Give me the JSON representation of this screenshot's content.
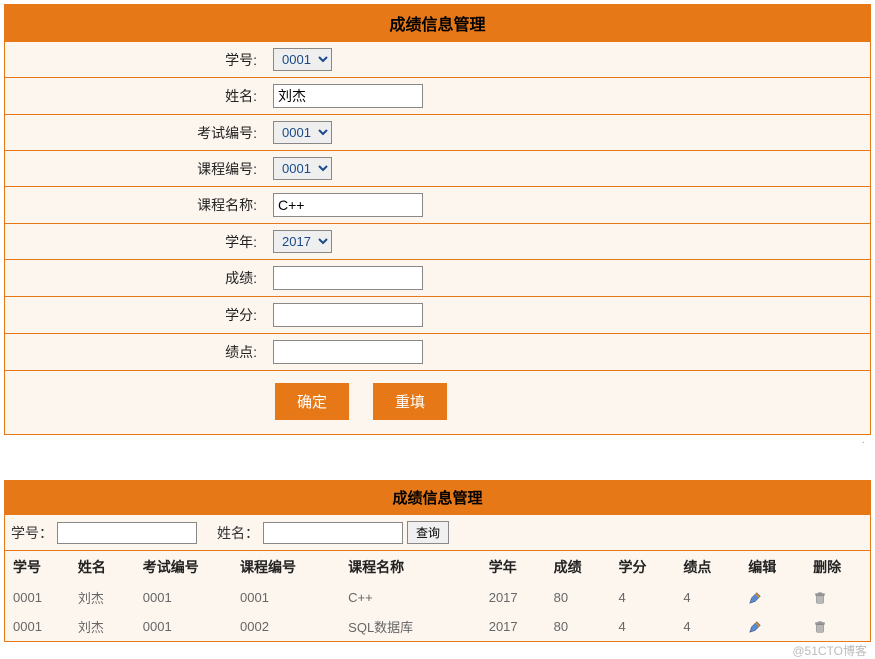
{
  "upper": {
    "title": "成绩信息管理",
    "fields": {
      "student_id": {
        "label": "学号:",
        "value": "0001"
      },
      "name": {
        "label": "姓名:",
        "value": "刘杰"
      },
      "exam_id": {
        "label": "考试编号:",
        "value": "0001"
      },
      "course_id": {
        "label": "课程编号:",
        "value": "0001"
      },
      "course_name": {
        "label": "课程名称:",
        "value": "C++"
      },
      "year": {
        "label": "学年:",
        "value": "2017"
      },
      "score": {
        "label": "成绩:",
        "value": ""
      },
      "credit": {
        "label": "学分:",
        "value": ""
      },
      "gpa": {
        "label": "绩点:",
        "value": ""
      }
    },
    "buttons": {
      "ok": "确定",
      "reset": "重填"
    }
  },
  "lower": {
    "title": "成绩信息管理",
    "search": {
      "id_label": "学号：",
      "name_label": "姓名：",
      "id_value": "",
      "name_value": "",
      "btn": "查询"
    },
    "columns": [
      "学号",
      "姓名",
      "考试编号",
      "课程编号",
      "课程名称",
      "学年",
      "成绩",
      "学分",
      "绩点",
      "编辑",
      "删除"
    ],
    "rows": [
      {
        "id": "0001",
        "name": "刘杰",
        "exam": "0001",
        "course": "0001",
        "cname": "C++",
        "year": "2017",
        "score": "80",
        "credit": "4",
        "gpa": "4"
      },
      {
        "id": "0001",
        "name": "刘杰",
        "exam": "0001",
        "course": "0002",
        "cname": "SQL数据库",
        "year": "2017",
        "score": "80",
        "credit": "4",
        "gpa": "4"
      }
    ]
  },
  "watermark": "@51CTO博客"
}
